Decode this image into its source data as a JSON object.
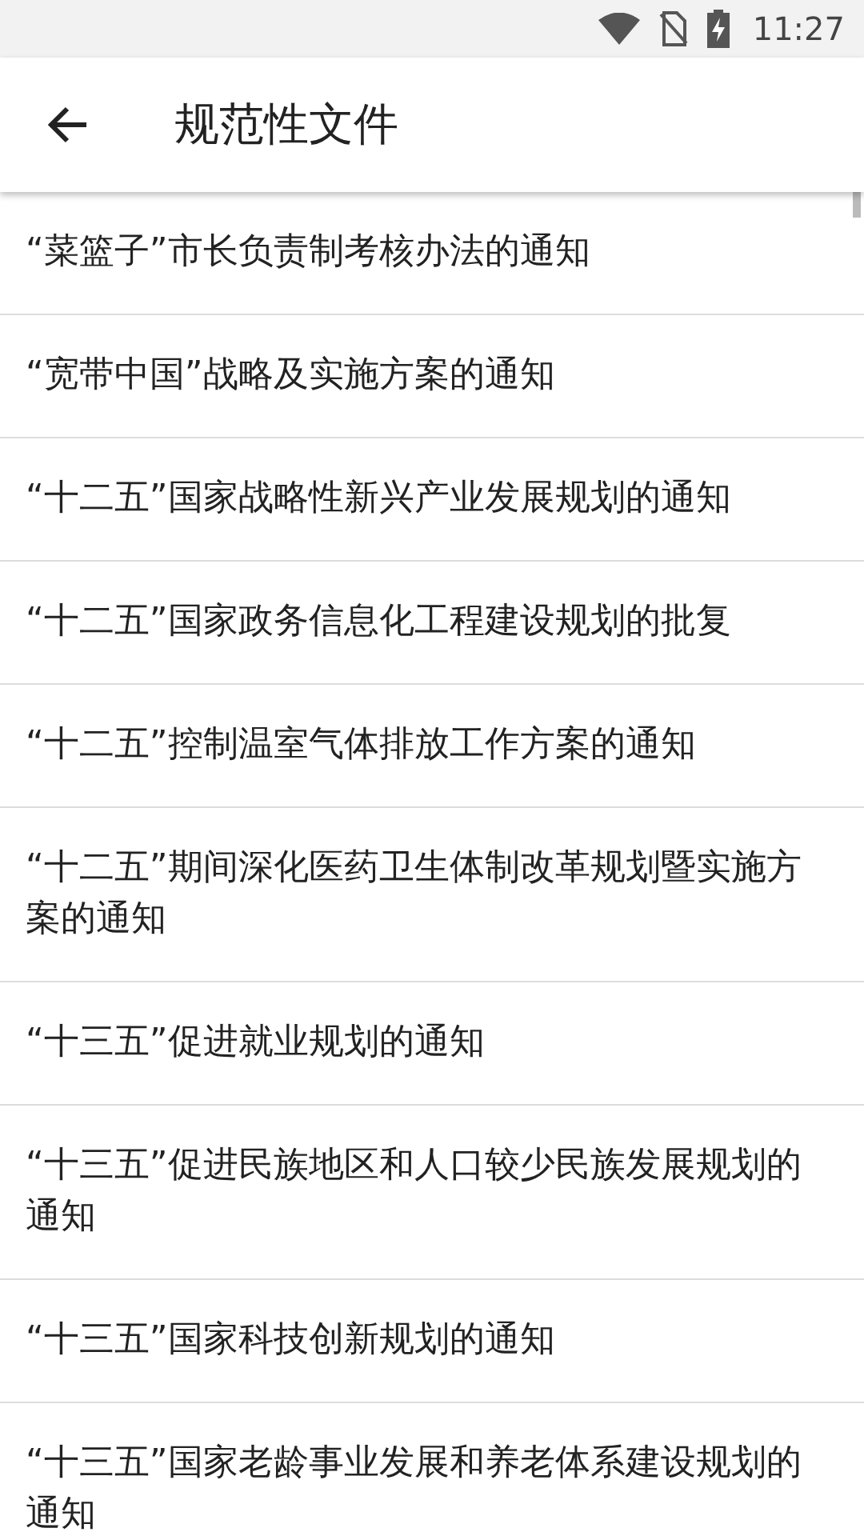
{
  "status_bar": {
    "time": "11:27"
  },
  "app_bar": {
    "title": "规范性文件"
  },
  "items": [
    {
      "title": "“菜篮子”市长负责制考核办法的通知"
    },
    {
      "title": "“宽带中国”战略及实施方案的通知"
    },
    {
      "title": "“十二五”国家战略性新兴产业发展规划的通知"
    },
    {
      "title": "“十二五”国家政务信息化工程建设规划的批复"
    },
    {
      "title": "“十二五”控制温室气体排放工作方案的通知"
    },
    {
      "title": "“十二五”期间深化医药卫生体制改革规划暨实施方案的通知"
    },
    {
      "title": "“十三五”促进就业规划的通知"
    },
    {
      "title": "“十三五”促进民族地区和人口较少民族发展规划的通知"
    },
    {
      "title": "“十三五”国家科技创新规划的通知"
    },
    {
      "title": "“十三五”国家老龄事业发展和养老体系建设规划的通知"
    }
  ]
}
